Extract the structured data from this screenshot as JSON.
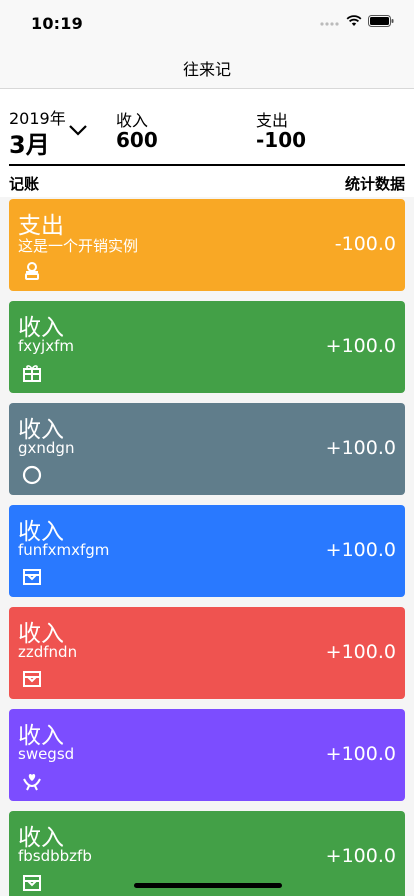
{
  "status_bar": {
    "time": "10:19",
    "icons": [
      "signal-icon",
      "wifi-icon",
      "battery-icon"
    ]
  },
  "nav": {
    "title": "往来记"
  },
  "summary": {
    "year": "2019年",
    "month": "3月",
    "income_label": "收入",
    "income_value": "600",
    "expense_label": "支出",
    "expense_value": "-100",
    "left_link": "记账",
    "right_link": "统计数据"
  },
  "entries": [
    {
      "type": "支出",
      "note": "这是一个开销实例",
      "amount": "-100.0",
      "color": "#f9a825",
      "icon": "person-icon"
    },
    {
      "type": "收入",
      "note": "fxyjxfm",
      "amount": "+100.0",
      "color": "#43a047",
      "icon": "gift-icon"
    },
    {
      "type": "收入",
      "note": "gxndgn",
      "amount": "+100.0",
      "color": "#607d8b",
      "icon": "circle-icon"
    },
    {
      "type": "收入",
      "note": "funfxmxfgm",
      "amount": "+100.0",
      "color": "#2979ff",
      "icon": "box-icon"
    },
    {
      "type": "收入",
      "note": "zzdfndn",
      "amount": "+100.0",
      "color": "#ef5350",
      "icon": "box-icon"
    },
    {
      "type": "收入",
      "note": "swegsd",
      "amount": "+100.0",
      "color": "#7c4dff",
      "icon": "heart-hand-icon"
    },
    {
      "type": "收入",
      "note": "fbsdbbzfb",
      "amount": "+100.0",
      "color": "#43a047",
      "icon": "box-icon"
    }
  ]
}
